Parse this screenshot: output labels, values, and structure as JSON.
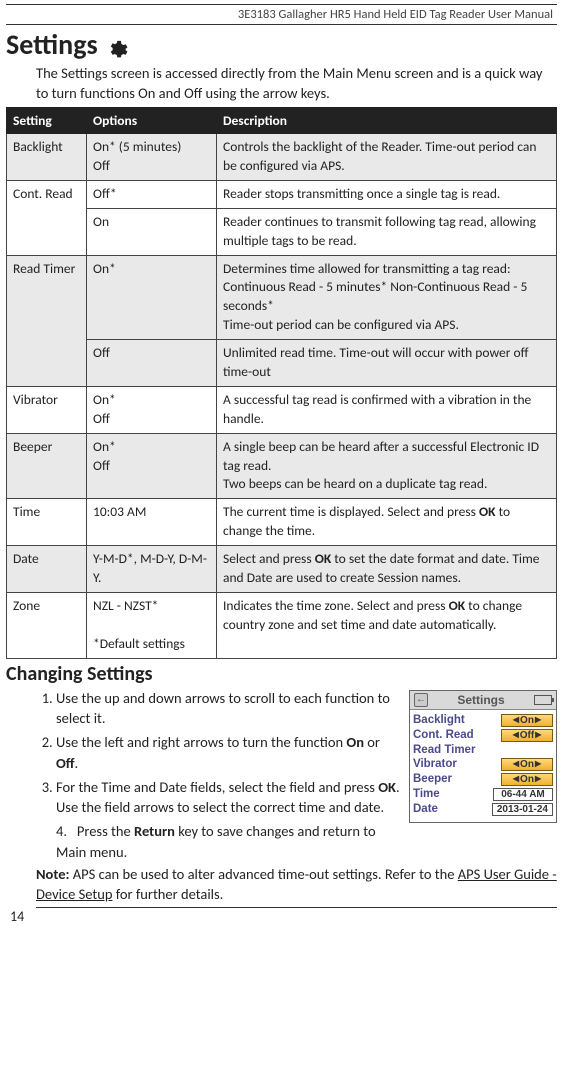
{
  "header": "3E3183 Gallagher HR5 Hand Held EID Tag Reader User Manual",
  "title": "Settings",
  "intro": "The Settings screen is accessed directly from the Main Menu screen and is a quick way to turn functions On and Off using the arrow keys.",
  "table": {
    "headers": [
      "Setting",
      "Options",
      "Description"
    ],
    "rows": [
      {
        "shade": true,
        "spans": [
          {
            "setting": "Backlight",
            "rowspan": 1
          }
        ],
        "option": "On*  (5 minutes)\nOff",
        "desc": "Controls the backlight of the Reader.  Time-out period can be configured via APS."
      },
      {
        "shade": false,
        "spans": [
          {
            "setting": "Cont. Read",
            "rowspan": 2
          }
        ],
        "option": "Off*",
        "desc": "Reader stops transmitting once a single tag is read."
      },
      {
        "shade": false,
        "cont": true,
        "option": "On",
        "desc": "Reader continues to transmit following tag read, allowing multiple tags to be read."
      },
      {
        "shade": true,
        "spans": [
          {
            "setting": "Read Timer",
            "rowspan": 2
          }
        ],
        "option": "On*",
        "desc": "Determines time allowed for transmitting a tag read: Continuous Read - 5 minutes* Non-Continuous Read - 5 seconds*\nTime-out period can be configured via APS."
      },
      {
        "shade": true,
        "cont": true,
        "option": "Off",
        "desc": "Unlimited read time. Time-out will occur with power off time-out"
      },
      {
        "shade": false,
        "spans": [
          {
            "setting": "Vibrator",
            "rowspan": 1
          }
        ],
        "option": "On*\nOff",
        "desc": "A successful tag read is confirmed with a vibration in the handle."
      },
      {
        "shade": true,
        "spans": [
          {
            "setting": "Beeper",
            "rowspan": 1
          }
        ],
        "option": "On*\nOff",
        "desc": "A single beep can be heard after a successful Electronic ID tag read.\nTwo beeps can be heard on a duplicate tag read."
      },
      {
        "shade": false,
        "spans": [
          {
            "setting": "Time",
            "rowspan": 1
          }
        ],
        "option": "10:03 AM",
        "desc": "The current time is displayed. Select and press <b>OK</b> to change the time."
      },
      {
        "shade": true,
        "spans": [
          {
            "setting": "Date",
            "rowspan": 1
          }
        ],
        "option": "Y-M-D*, M-D-Y, D-M-Y.",
        "desc": "Select and press <b>OK</b> to set the date format and date. Time and Date are used to create Session names."
      },
      {
        "shade": false,
        "spans": [
          {
            "setting": "Zone",
            "rowspan": 1
          }
        ],
        "option": "NZL - NZST*\n\n*Default settings",
        "desc": "Indicates the time zone. Select and press <b>OK</b> to change country zone and set time and date automatically."
      }
    ]
  },
  "subheading": "Changing Settings",
  "steps": [
    "Use the up and down arrows to scroll to each function to select it.",
    "Use the left and right arrows to turn the function <b>On</b> or <b>Off</b>.",
    "For the Time and Date fields, select the field and press <b>OK</b>. Use the field arrows to select the correct time and date."
  ],
  "step4": "Press the <b>Return</b> key to save changes and return to Main menu.",
  "note_label": "Note:",
  "note_body": " APS can be used to alter advanced time-out settings. Refer to the <span class='u'>APS User Guide - Device Setup</span> for further details.",
  "pagenum": "14",
  "screenshot": {
    "title": "Settings",
    "rows": [
      {
        "label": "Backlight",
        "btn": "On",
        "type": "btn"
      },
      {
        "label": "Cont. Read",
        "btn": "Off",
        "type": "btn"
      },
      {
        "label": "Read Timer",
        "btn": "",
        "type": "none"
      },
      {
        "label": "Vibrator",
        "btn": "On",
        "type": "btn"
      },
      {
        "label": "Beeper",
        "btn": "On",
        "type": "btn"
      },
      {
        "label": "Time",
        "btn": "06-44 AM",
        "type": "field"
      },
      {
        "label": "Date",
        "btn": "2013-01-24",
        "type": "field"
      }
    ]
  }
}
